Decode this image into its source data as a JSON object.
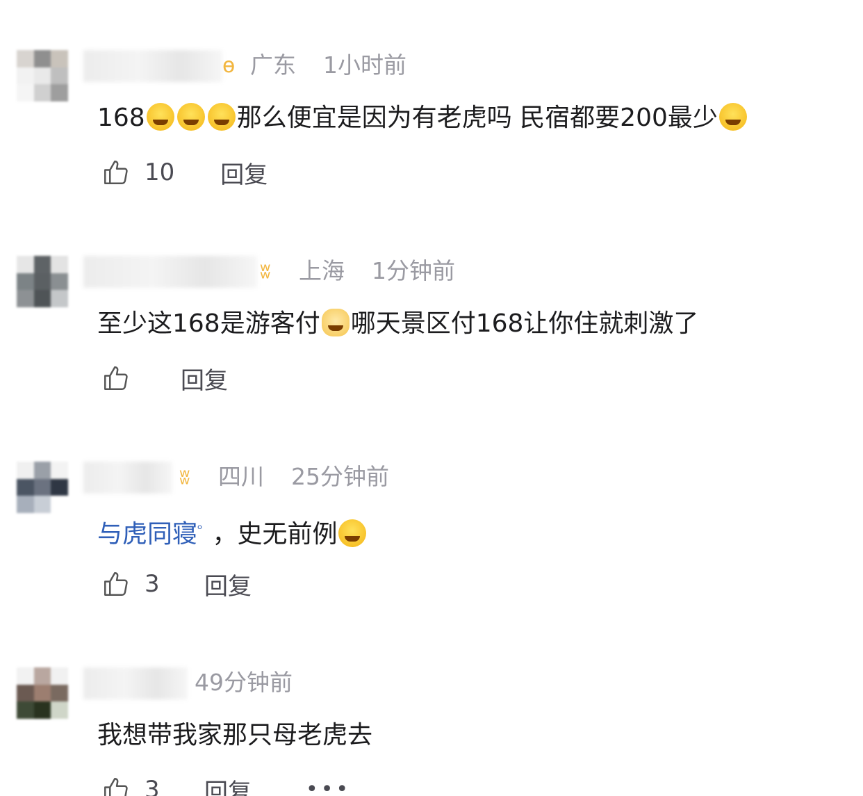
{
  "comments": [
    {
      "location": "广东",
      "time": "1小时前",
      "text_a": "168",
      "text_b": "那么便宜是因为有老虎吗 民宿都要200最少",
      "likes": "10",
      "reply_label": "回复"
    },
    {
      "location": "上海",
      "time": "1分钟前",
      "text_a": "至少这168是游客付",
      "text_b": "哪天景区付168让你住就刺激了",
      "likes": "",
      "reply_label": "回复"
    },
    {
      "location": "四川",
      "time": "25分钟前",
      "link_text": "与虎同寝",
      "text_b": "，史无前例",
      "likes": "3",
      "reply_label": "回复"
    },
    {
      "location": "",
      "time": "49分钟前",
      "text_a": "我想带我家那只母老虎去",
      "likes": "3",
      "reply_label": "回复"
    }
  ],
  "more_label": "•••",
  "colors": {
    "text": "#1c1c1e",
    "meta": "#9a9aa2",
    "link": "#2f5fb8",
    "badge": "#f2b640"
  },
  "icons": {
    "like": "thumbs-up-icon",
    "badge": "butterfly-badge-icon",
    "search": "search-superscript-icon"
  }
}
